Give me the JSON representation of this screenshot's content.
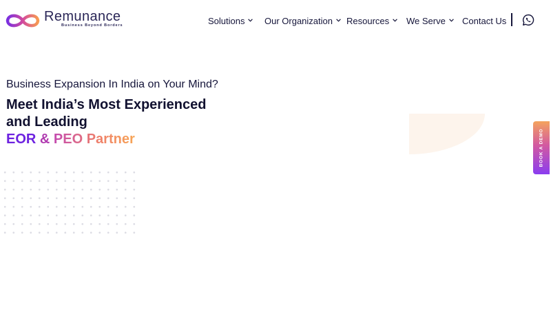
{
  "brand": {
    "name": "Remunance",
    "tagline": "Business Beyond Borders",
    "colors": {
      "violet": "#6d22e0",
      "magenta": "#c34ab0",
      "orange": "#f7a657",
      "navy": "#15153a"
    }
  },
  "nav": {
    "items": [
      {
        "label": "Solutions",
        "has_dropdown": true
      },
      {
        "label": "Our Organization",
        "has_dropdown": true
      },
      {
        "label": "Resources",
        "has_dropdown": true
      },
      {
        "label": "We Serve",
        "has_dropdown": true
      },
      {
        "label": "Contact Us",
        "has_dropdown": false
      }
    ],
    "contact_icon": "whatsapp-icon"
  },
  "hero": {
    "kicker": "Business Expansion In India on Your Mind?",
    "title_line1": "Meet India’s Most Experienced",
    "title_line2": "and Leading",
    "accent_part1": "EOR",
    "accent_amp": "&",
    "accent_part2": "PEO Partner"
  },
  "side_tab": {
    "label": "BOOK A DEMO"
  }
}
